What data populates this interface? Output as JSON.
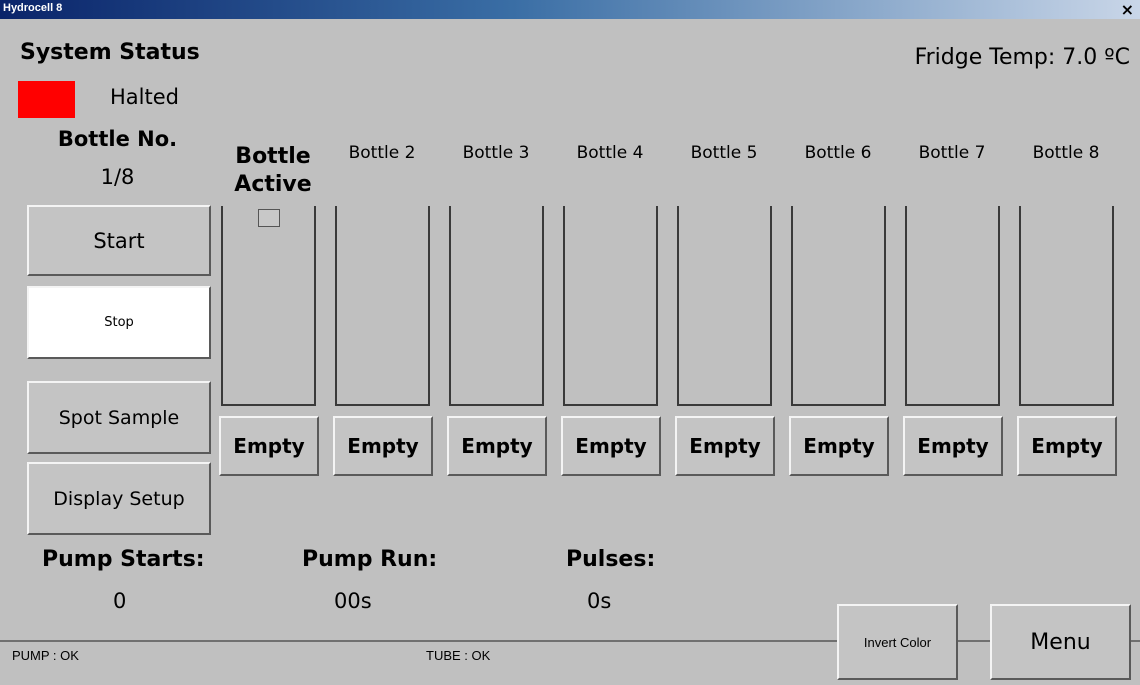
{
  "window": {
    "title": "Hydrocell 8",
    "close_glyph": "×"
  },
  "status": {
    "heading": "System Status",
    "indicator_color": "#ff0000",
    "state": "Halted",
    "fridge_temp": "Fridge Temp: 7.0 ºC"
  },
  "bottle_no": {
    "label": "Bottle No.",
    "value": "1/8"
  },
  "bottle_active": {
    "label_line1": "Bottle",
    "label_line2": "Active"
  },
  "buttons": {
    "start": "Start",
    "stop": "Stop",
    "spot_sample": "Spot Sample",
    "display_setup": "Display Setup",
    "invert_color": "Invert Color",
    "menu": "Menu"
  },
  "bottles": [
    {
      "name": "Bottle 2",
      "state": "Empty"
    },
    {
      "name": "Bottle 3",
      "state": "Empty"
    },
    {
      "name": "Bottle 4",
      "state": "Empty"
    },
    {
      "name": "Bottle 5",
      "state": "Empty"
    },
    {
      "name": "Bottle 6",
      "state": "Empty"
    },
    {
      "name": "Bottle 7",
      "state": "Empty"
    },
    {
      "name": "Bottle 8",
      "state": "Empty"
    }
  ],
  "bottle1_state": "Empty",
  "stats": {
    "pump_starts_label": "Pump Starts:",
    "pump_starts_value": "0",
    "pump_run_label": "Pump Run:",
    "pump_run_value": "00s",
    "pulses_label": "Pulses:",
    "pulses_value": "0s"
  },
  "footer": {
    "pump_status": "PUMP : OK",
    "tube_status": "TUBE : OK"
  }
}
